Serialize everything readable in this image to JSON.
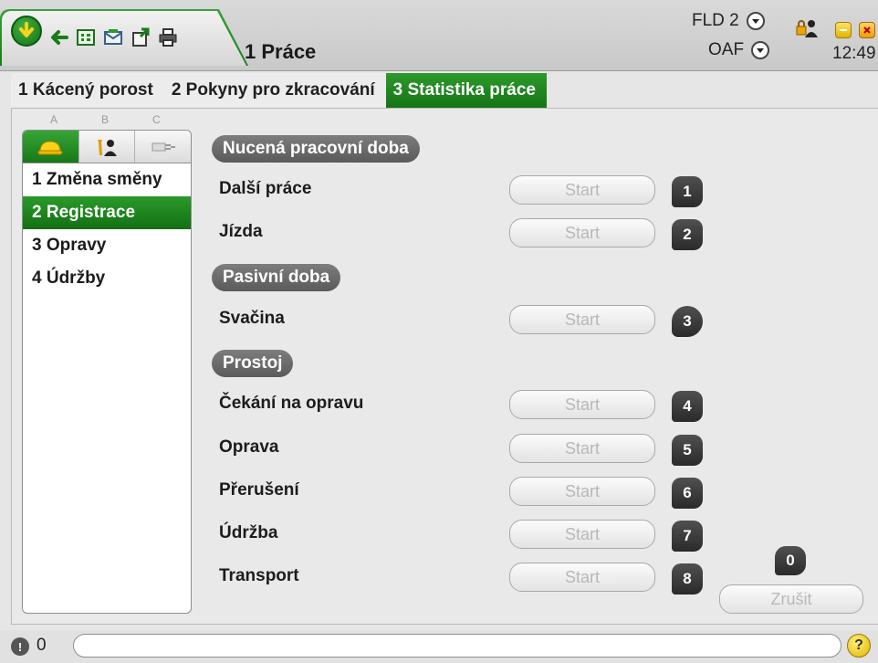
{
  "header": {
    "title": "1 Práce",
    "machine": "FLD 2",
    "operator": "OAF",
    "time": "12:49"
  },
  "icons": {
    "home": "down-arrow-circle-icon",
    "back": "left-arrow-icon",
    "tools": [
      "grid-icon",
      "mail-icon",
      "export-icon",
      "print-icon"
    ],
    "lock": "user-lock-icon",
    "minimize": "minimize-icon",
    "close": "close-icon",
    "help": "help-icon",
    "alarm": "alarm-icon"
  },
  "tabs": [
    {
      "label": "1 Kácený porost",
      "active": false
    },
    {
      "label": "2 Pokyny pro zkracování",
      "active": false
    },
    {
      "label": "3 Statistika práce",
      "active": true
    }
  ],
  "column_letters": [
    "A",
    "B",
    "C"
  ],
  "nav": {
    "icon_tabs": [
      "hard-hat-icon",
      "mechanic-icon",
      "plug-icon"
    ],
    "items": [
      {
        "label": "1 Změna směny",
        "active": false
      },
      {
        "label": "2 Registrace",
        "active": true
      },
      {
        "label": "3 Opravy",
        "active": false
      },
      {
        "label": "4 Údržby",
        "active": false
      }
    ]
  },
  "sections": [
    {
      "title": "Nucená pracovní doba"
    },
    {
      "title": "Pasivní doba"
    },
    {
      "title": "Prostoj"
    }
  ],
  "rows": [
    {
      "label": "Další práce",
      "button": "Start",
      "key": "1"
    },
    {
      "label": "Jízda",
      "button": "Start",
      "key": "2"
    },
    {
      "label": "Svačina",
      "button": "Start",
      "key": "3"
    },
    {
      "label": "Čekání na opravu",
      "button": "Start",
      "key": "4"
    },
    {
      "label": "Oprava",
      "button": "Start",
      "key": "5"
    },
    {
      "label": "Přerušení",
      "button": "Start",
      "key": "6"
    },
    {
      "label": "Údržba",
      "button": "Start",
      "key": "7"
    },
    {
      "label": "Transport",
      "button": "Start",
      "key": "8"
    }
  ],
  "cancel": {
    "label": "Zrušit",
    "key": "0"
  },
  "statusbar": {
    "alarm_count": "0",
    "message": "",
    "help_label": "?"
  },
  "colors": {
    "accent_green": "#1f8a1f",
    "section_pill": "#666666",
    "badge": "#3a3a3a",
    "help_yellow": "#f3cc20"
  }
}
